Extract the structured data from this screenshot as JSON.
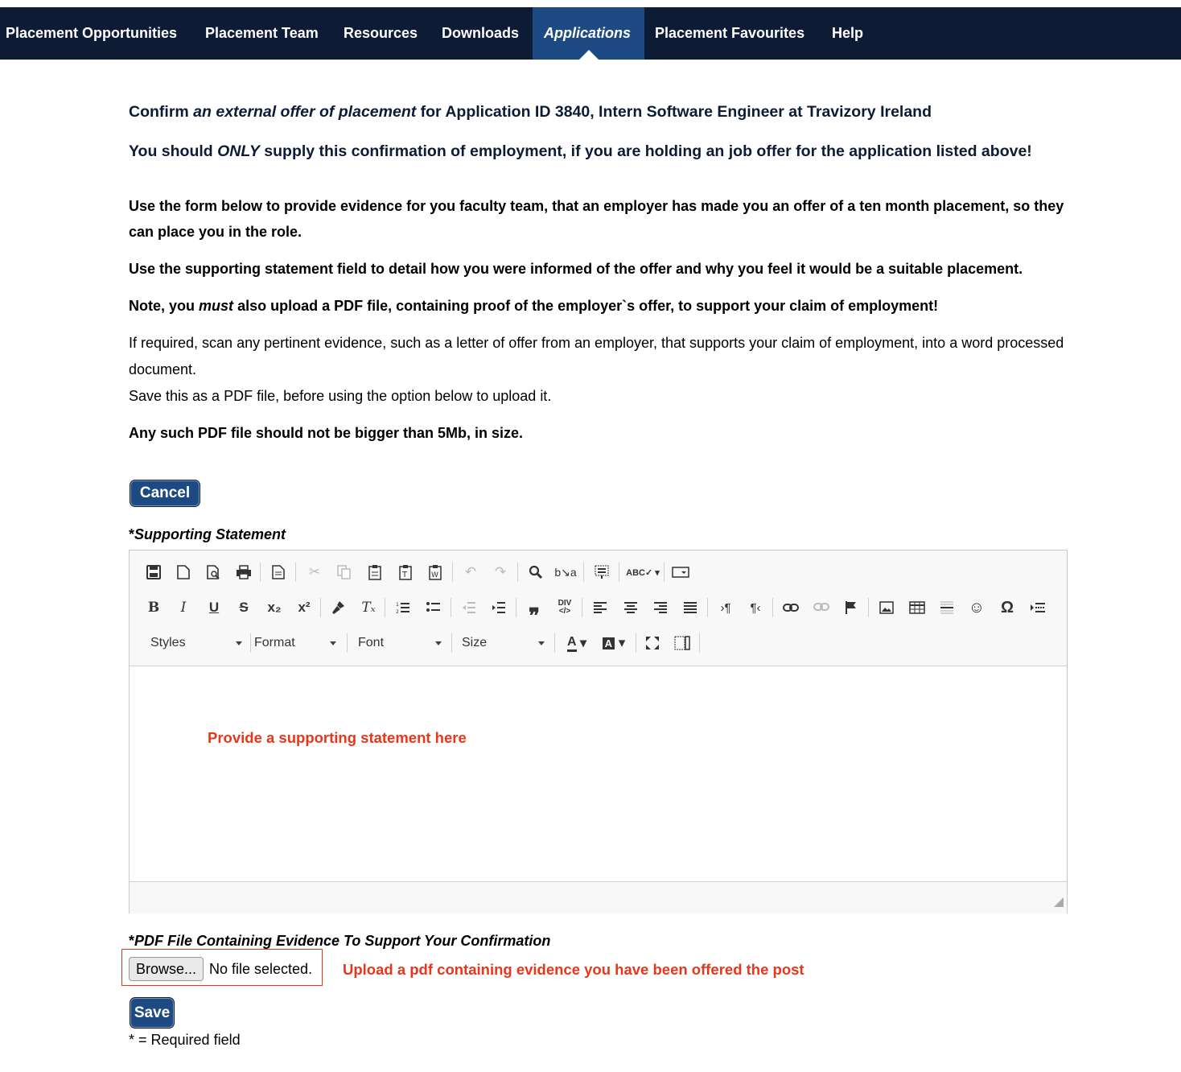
{
  "nav": {
    "items": [
      {
        "label": "Placement Opportunities"
      },
      {
        "label": "Placement Team"
      },
      {
        "label": "Resources"
      },
      {
        "label": "Downloads"
      },
      {
        "label": "Applications",
        "active": true
      },
      {
        "label": "Placement Favourites"
      },
      {
        "label": "Help"
      }
    ]
  },
  "header": {
    "confirm_prefix": "Confirm",
    "confirm_emphasis": "an external offer of placement",
    "confirm_suffix": "for Application ID 3840, Intern Software Engineer at Travizory Ireland",
    "warning_prefix": "You should",
    "warning_emphasis": "ONLY",
    "warning_suffix": "supply this confirmation of employment, if you are holding an job offer for the application listed above!"
  },
  "instructions": {
    "p1": "Use the form below to provide evidence for you faculty team, that an employer has made you an offer of a ten month placement, so they can place you in the role.",
    "p2": "Use the supporting statement field to detail how you were informed of the offer and why you feel it would be a suitable placement.",
    "p3_prefix": "Note, you",
    "p3_emphasis": "must",
    "p3_suffix": "also upload a PDF file, containing proof of the employer`s offer, to support your claim of employment!",
    "p4": "If required, scan any pertinent evidence, such as a letter of offer from an employer, that supports your claim of employment, into a word processed document.",
    "p5": "Save this as a PDF file, before using the option below to upload it.",
    "p6": "Any such PDF file should not be bigger than 5Mb, in size."
  },
  "buttons": {
    "cancel": "Cancel",
    "save": "Save",
    "browse": "Browse..."
  },
  "statement": {
    "label_star": "*",
    "label": "Supporting Statement",
    "placeholder": "Provide a supporting statement here"
  },
  "editor": {
    "combos": [
      "Styles",
      "Format",
      "Font",
      "Size"
    ]
  },
  "upload": {
    "label_star": "*",
    "label": "PDF File Containing Evidence To Support Your Confirmation",
    "file_status": "No file selected.",
    "note": "Upload a pdf containing evidence you have been offered the post"
  },
  "footer": {
    "required_note": "* = Required field"
  },
  "colors": {
    "nav_bg": "#0d1b35",
    "nav_active": "#1e4a84",
    "button": "#1e4a84",
    "warning_red": "#e8361b"
  }
}
